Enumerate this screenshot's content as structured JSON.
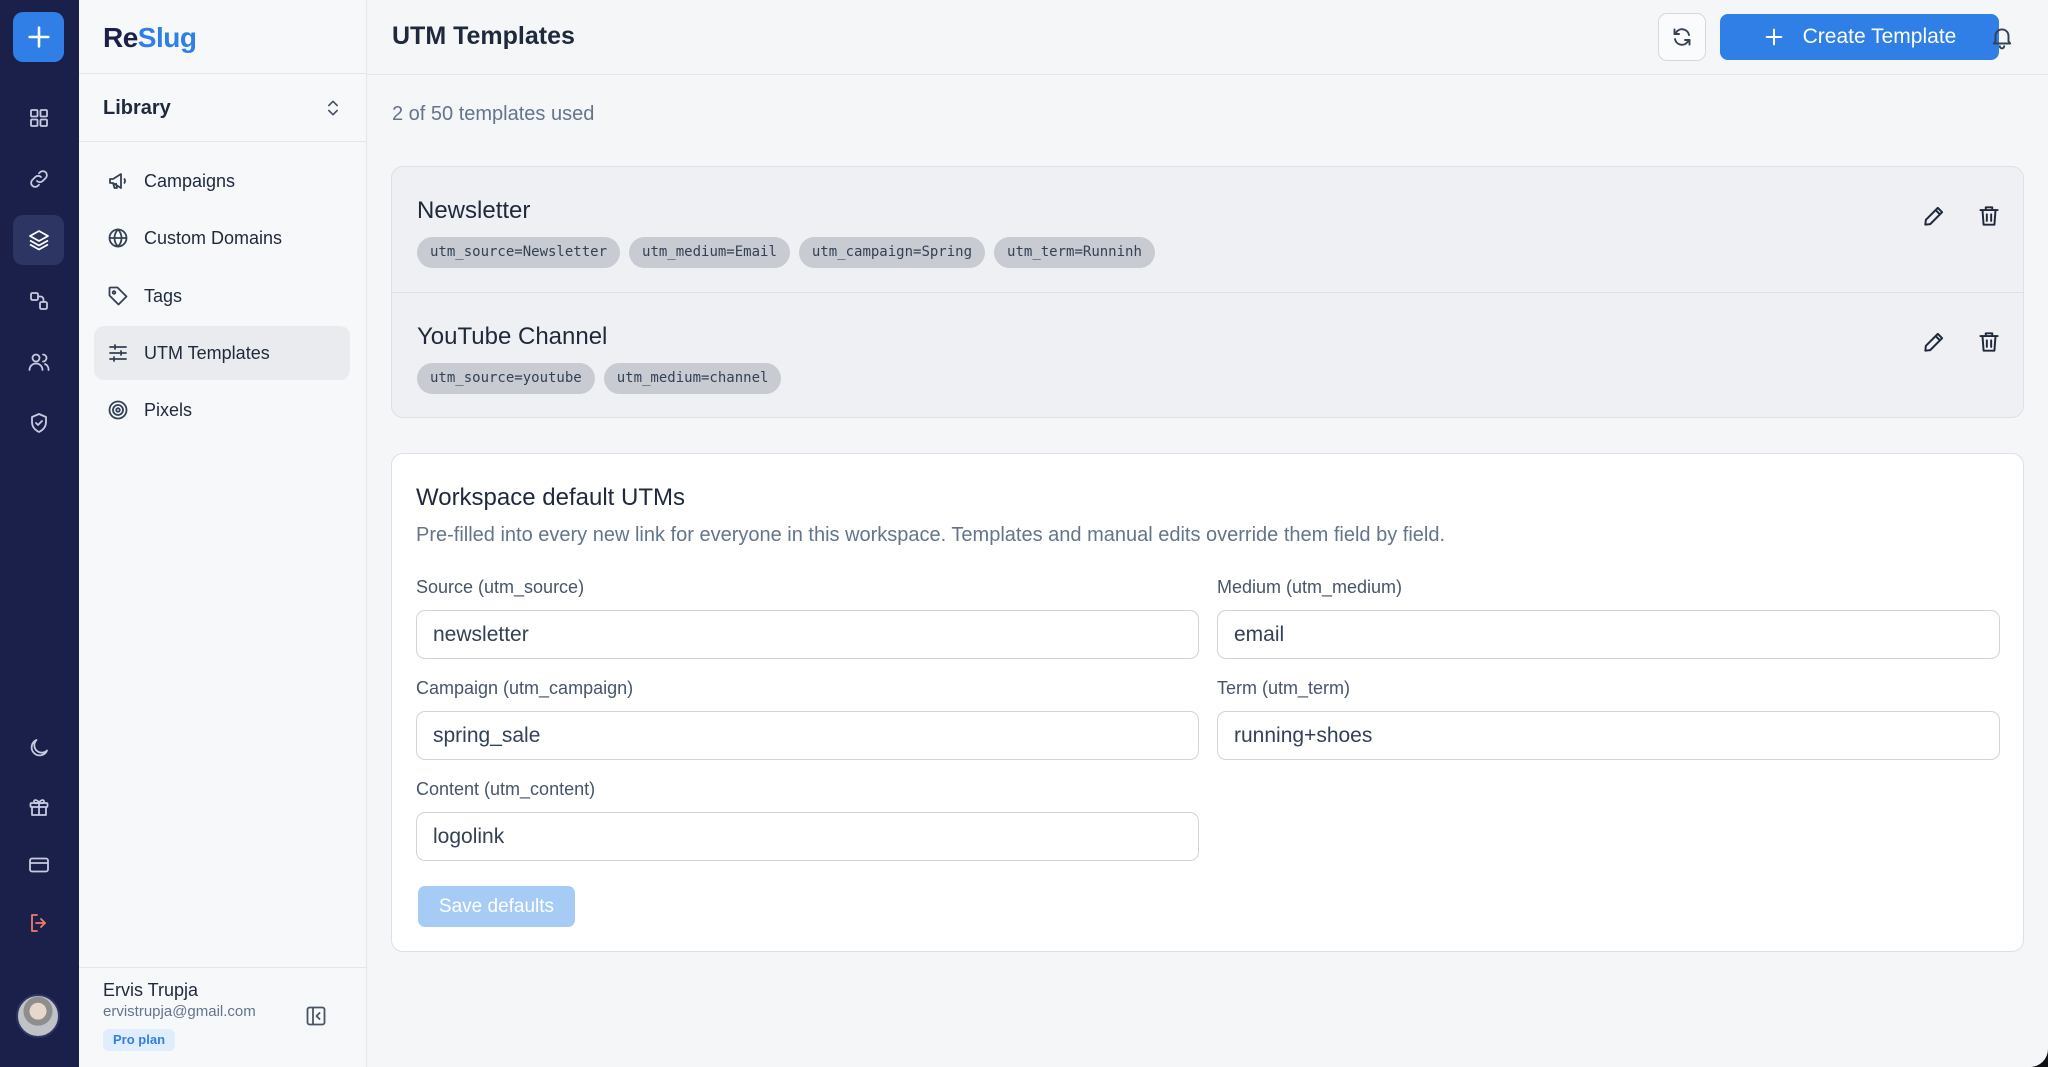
{
  "brand": {
    "part1": "Re",
    "part2": "Slug"
  },
  "rail": {
    "items": [
      {
        "name": "dashboard-icon"
      },
      {
        "name": "link-icon"
      },
      {
        "name": "layers-icon"
      },
      {
        "name": "integrations-icon"
      },
      {
        "name": "users-icon"
      },
      {
        "name": "shield-icon"
      },
      {
        "name": "moon-icon"
      },
      {
        "name": "gift-icon"
      },
      {
        "name": "credit-card-icon"
      },
      {
        "name": "logout-icon"
      }
    ],
    "active": "layers-icon"
  },
  "sidebar": {
    "section_label": "Library",
    "items": [
      {
        "label": "Campaigns",
        "icon": "megaphone-icon"
      },
      {
        "label": "Custom Domains",
        "icon": "globe-icon"
      },
      {
        "label": "Tags",
        "icon": "tag-icon"
      },
      {
        "label": "UTM Templates",
        "icon": "sliders-icon"
      },
      {
        "label": "Pixels",
        "icon": "target-icon"
      }
    ],
    "active": "UTM Templates"
  },
  "user": {
    "name": "Ervis Trupja",
    "email": "ervistrupja@gmail.com",
    "plan": "Pro plan"
  },
  "header": {
    "title": "UTM Templates",
    "create_label": "Create Template"
  },
  "usage_text": "2 of 50 templates used",
  "templates": [
    {
      "name": "Newsletter",
      "params": [
        "utm_source=Newsletter",
        "utm_medium=Email",
        "utm_campaign=Spring",
        "utm_term=Runninh"
      ]
    },
    {
      "name": "YouTube Channel",
      "params": [
        "utm_source=youtube",
        "utm_medium=channel"
      ]
    }
  ],
  "defaults": {
    "title": "Workspace default UTMs",
    "description": "Pre-filled into every new link for everyone in this workspace. Templates and manual edits override them field by field.",
    "fields": {
      "source": {
        "label": "Source (utm_source)",
        "value": "newsletter"
      },
      "medium": {
        "label": "Medium (utm_medium)",
        "value": "email"
      },
      "campaign": {
        "label": "Campaign (utm_campaign)",
        "value": "spring_sale"
      },
      "term": {
        "label": "Term (utm_term)",
        "value": "running+shoes"
      },
      "content": {
        "label": "Content (utm_content)",
        "value": "logolink"
      }
    },
    "save_label": "Save defaults"
  },
  "colors": {
    "rail_bg": "#1a2049",
    "accent": "#2f7fe6",
    "save_disabled": "#a6ccf6"
  }
}
